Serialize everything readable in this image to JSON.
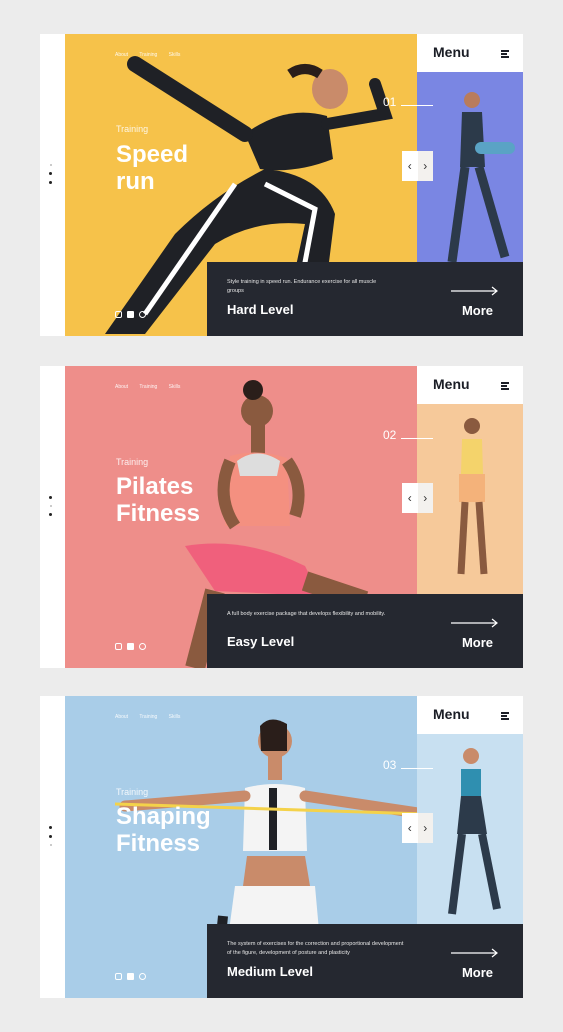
{
  "cards": [
    {
      "nav": [
        "About",
        "Training",
        "Skills"
      ],
      "eyebrow": "Training",
      "title_line1": "Speed",
      "title_line2": "run",
      "number": "01",
      "menu_label": "Menu",
      "description": "Style training in speed run. Endurance exercise for all muscle groups",
      "level": "Hard Level",
      "more": "More",
      "hero_color": "#f6c24a",
      "side_color": "#7a86e3"
    },
    {
      "nav": [
        "About",
        "Training",
        "Skills"
      ],
      "eyebrow": "Training",
      "title_line1": "Pilates",
      "title_line2": "Fitness",
      "number": "02",
      "menu_label": "Menu",
      "description": "A full body exercise package that develops flexibility and mobility.",
      "level": "Easy Level",
      "more": "More",
      "hero_color": "#ee8e8a",
      "side_color": "#f6c99a"
    },
    {
      "nav": [
        "About",
        "Training",
        "Skills"
      ],
      "eyebrow": "Training",
      "title_line1": "Shaping",
      "title_line2": "Fitness",
      "number": "03",
      "menu_label": "Menu",
      "description": "The system of exercises for the correction and proportional development of the figure, development of posture and plasticity",
      "level": "Medium Level",
      "more": "More",
      "hero_color": "#a9cde8",
      "side_color": "#c8e0f1"
    }
  ]
}
